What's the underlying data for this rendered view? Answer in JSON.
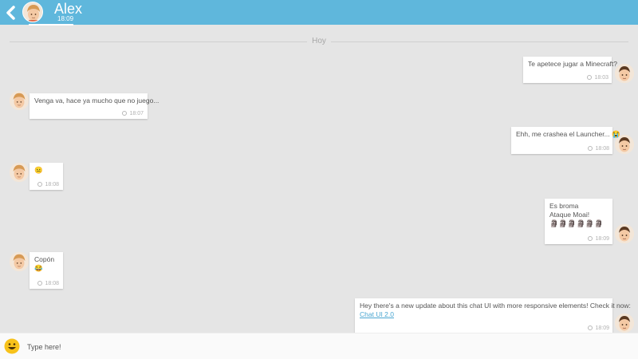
{
  "header": {
    "contact_name": "Alex",
    "last_seen": "18:09",
    "back_icon": "chevron-left-icon",
    "color": "#5fb7dc"
  },
  "day_separator": "Hoy",
  "messages": [
    {
      "from": "me",
      "text": "Te apetece jugar a Minecraft?",
      "time": "18:03"
    },
    {
      "from": "alex",
      "text": "Venga va, hace ya mucho que no juego...",
      "time": "18:07"
    },
    {
      "from": "me",
      "text": "Ehh, me crashea el Launcher...",
      "emoji": "😭",
      "time": "18:08"
    },
    {
      "from": "alex",
      "text": "😐",
      "time": "18:08"
    },
    {
      "from": "me",
      "lines": [
        "Es broma",
        "Ataque Moai!"
      ],
      "emoji": "🗿🗿🗿🗿🗿🗿",
      "time": "18:09"
    },
    {
      "from": "alex",
      "text": "Copón",
      "emoji": "😂",
      "time": "18:08"
    },
    {
      "from": "me",
      "text": "Hey there's a new update about this chat UI with more responsive elements! Check it now:",
      "link": "Chat UI 2.0",
      "time": "18:09"
    }
  ],
  "composer": {
    "placeholder": "Type here!",
    "emoji_icon": "smiley-icon"
  },
  "colors": {
    "background": "#e5e5e5",
    "bubble": "#ffffff",
    "link": "#4aa6d1"
  }
}
